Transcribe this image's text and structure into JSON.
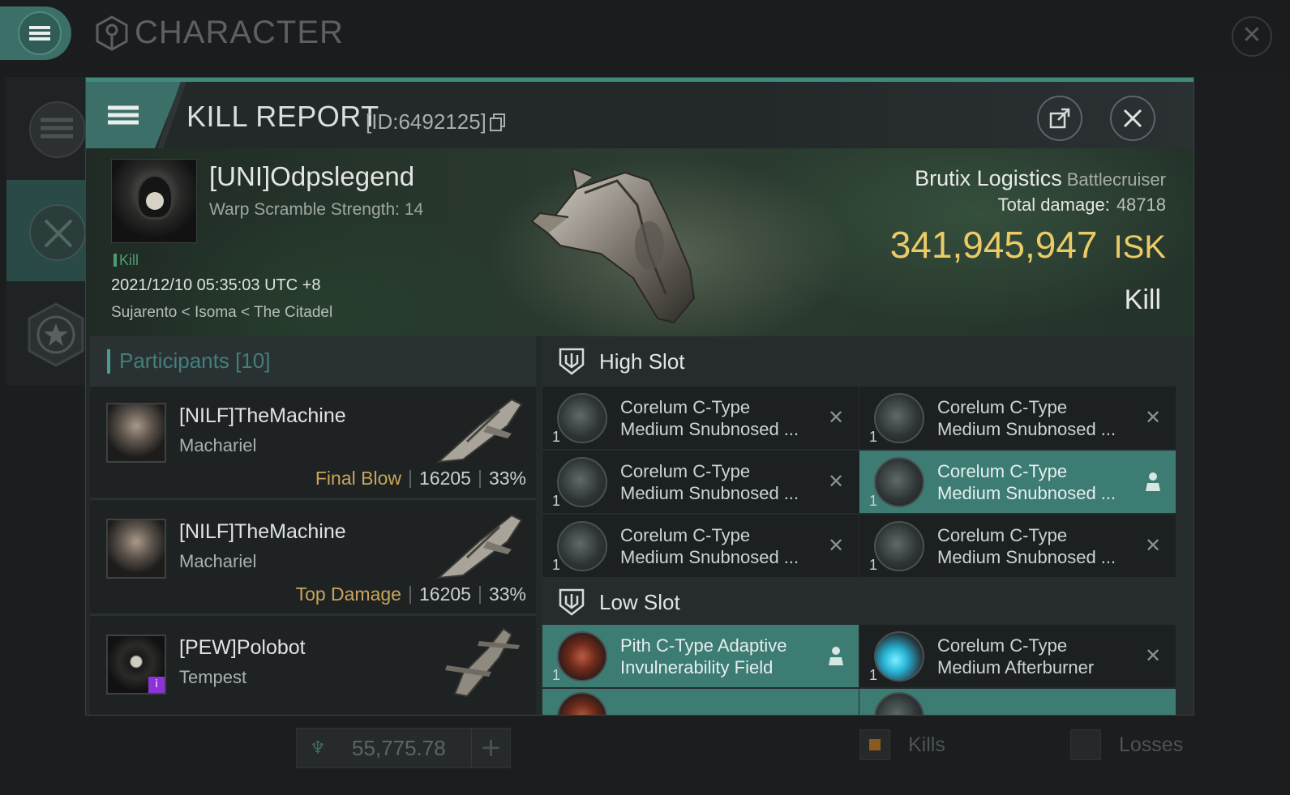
{
  "app": {
    "title": "CHARACTER",
    "close_label": "✕"
  },
  "modal": {
    "title": "KILL REPORT",
    "id": "[ID:6492125]",
    "share_icon": "external-link-icon",
    "close_icon": "close-icon"
  },
  "victim": {
    "name": "[UNI]Odpslegend",
    "warp": "Warp Scramble Strength: 14",
    "tag": "Kill",
    "datetime": "2021/12/10 05:35:03 UTC +8",
    "location": "Sujarento < Isoma < The Citadel",
    "ship_name": "Brutix Logistics",
    "ship_class": "Battlecruiser",
    "damage_label": "Total damage:",
    "damage_value": "48718",
    "isk_value": "341,945,947",
    "isk_unit": "ISK",
    "report_type": "Kill"
  },
  "participants": {
    "title": "Participants [10]",
    "rows": [
      {
        "name": "[NILF]TheMachine",
        "ship": "Machariel",
        "role": "Final Blow",
        "damage": "16205",
        "percent": "33%"
      },
      {
        "name": "[NILF]TheMachine",
        "ship": "Machariel",
        "role": "Top Damage",
        "damage": "16205",
        "percent": "33%"
      },
      {
        "name": "[PEW]Polobot",
        "ship": "Tempest",
        "badge": "i"
      }
    ]
  },
  "fitting": {
    "high_slot_label": "High Slot",
    "low_slot_label": "Low Slot",
    "high": [
      {
        "line1": "Corelum C-Type",
        "line2": "Medium Snubnosed ...",
        "qty": "1",
        "state": "destroyed"
      },
      {
        "line1": "Corelum C-Type",
        "line2": "Medium Snubnosed ...",
        "qty": "1",
        "state": "destroyed"
      },
      {
        "line1": "Corelum C-Type",
        "line2": "Medium Snubnosed ...",
        "qty": "1",
        "state": "destroyed"
      },
      {
        "line1": "Corelum C-Type",
        "line2": "Medium Snubnosed ...",
        "qty": "1",
        "state": "dropped"
      },
      {
        "line1": "Corelum C-Type",
        "line2": "Medium Snubnosed ...",
        "qty": "1",
        "state": "destroyed"
      },
      {
        "line1": "Corelum C-Type",
        "line2": "Medium Snubnosed ...",
        "qty": "1",
        "state": "destroyed"
      }
    ],
    "low": [
      {
        "line1": "Pith C-Type Adaptive",
        "line2": "Invulnerability Field",
        "qty": "1",
        "state": "dropped"
      },
      {
        "line1": "Corelum C-Type",
        "line2": "Medium Afterburner",
        "qty": "1",
        "state": "destroyed"
      }
    ]
  },
  "footer": {
    "currency_value": "55,775.78",
    "plus": "+",
    "kills_label": "Kills",
    "losses_label": "Losses"
  }
}
